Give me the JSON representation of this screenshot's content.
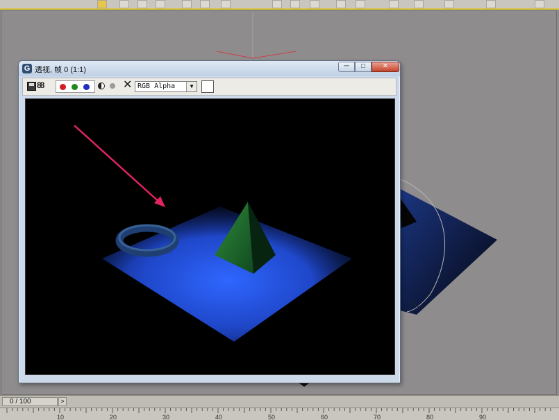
{
  "window": {
    "title": "透视, 帧 0 (1:1)",
    "app_icon_glyph": "G",
    "min_glyph": "─",
    "max_glyph": "□",
    "close_glyph": "✕"
  },
  "toolbar": {
    "clone_glyph": "88",
    "clear_glyph": "✕",
    "channel_selected": "RGB Alpha",
    "select_arrow_glyph": "▼"
  },
  "icons": {
    "save": "save-icon",
    "clone": "clone-frame-icon",
    "red": "red-channel-icon",
    "green": "green-channel-icon",
    "blue": "blue-channel-icon",
    "mono": "monochrome-icon",
    "alpha": "alpha-channel-icon",
    "clear": "clear-icon"
  },
  "colors": {
    "red_channel": "#d02020",
    "green_channel": "#1d8a1d",
    "blue_channel": "#1f2fc0",
    "annotation_arrow": "#e0245e",
    "plane": "#1f47c9",
    "pyramid": "#1f6b2e",
    "torus": "#1f3f73"
  },
  "timeline": {
    "position": "0 / 100",
    "next_glyph": ">"
  },
  "ruler": {
    "labels": [
      "10",
      "20",
      "30",
      "40",
      "50",
      "60",
      "70",
      "80",
      "90"
    ]
  }
}
